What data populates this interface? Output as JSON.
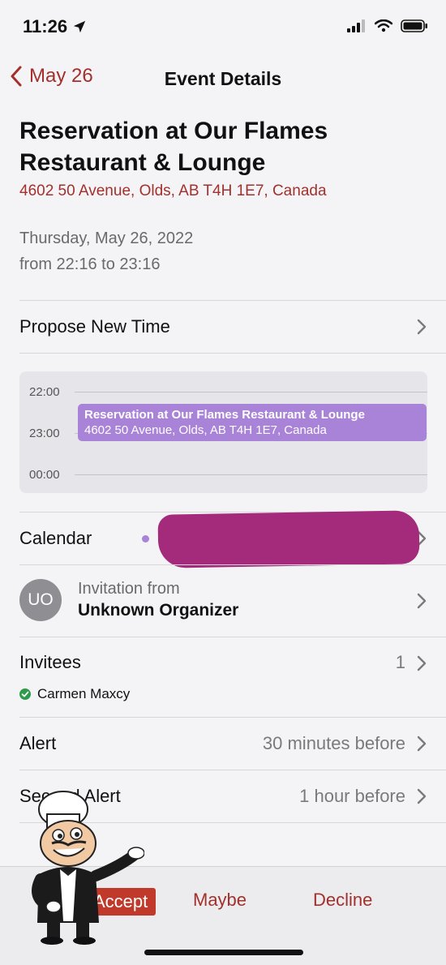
{
  "status_bar": {
    "time": "11:26"
  },
  "nav": {
    "back_label": "May 26",
    "title": "Event Details"
  },
  "event": {
    "title_line1": "Reservation at Our Flames",
    "title_line2": "Restaurant & Lounge",
    "address": "4602 50 Avenue, Olds, AB T4H 1E7, Canada",
    "date": "Thursday, May 26, 2022",
    "time_range": "from 22:16 to 23:16"
  },
  "propose": {
    "label": "Propose New Time"
  },
  "day_view": {
    "hours": [
      "22:00",
      "23:00",
      "00:00"
    ],
    "event_title": "Reservation at Our Flames Restaurant & Lounge",
    "event_subtitle": "4602 50 Avenue, Olds, AB T4H 1E7, Canada"
  },
  "calendar": {
    "label": "Calendar"
  },
  "organizer": {
    "initials": "UO",
    "caption": "Invitation from",
    "name": "Unknown Organizer"
  },
  "invitees": {
    "label": "Invitees",
    "count": "1",
    "people": [
      "Carmen Maxcy"
    ]
  },
  "alert": {
    "label": "Alert",
    "value": "30 minutes before"
  },
  "second_alert": {
    "label": "Second Alert",
    "value": "1 hour before"
  },
  "toolbar": {
    "accept": "Accept",
    "maybe": "Maybe",
    "decline": "Decline"
  },
  "colors": {
    "accent": "#a3302c",
    "event": "#a983d8",
    "redaction": "#a42a7c",
    "accepted": "#2e9b4a"
  }
}
